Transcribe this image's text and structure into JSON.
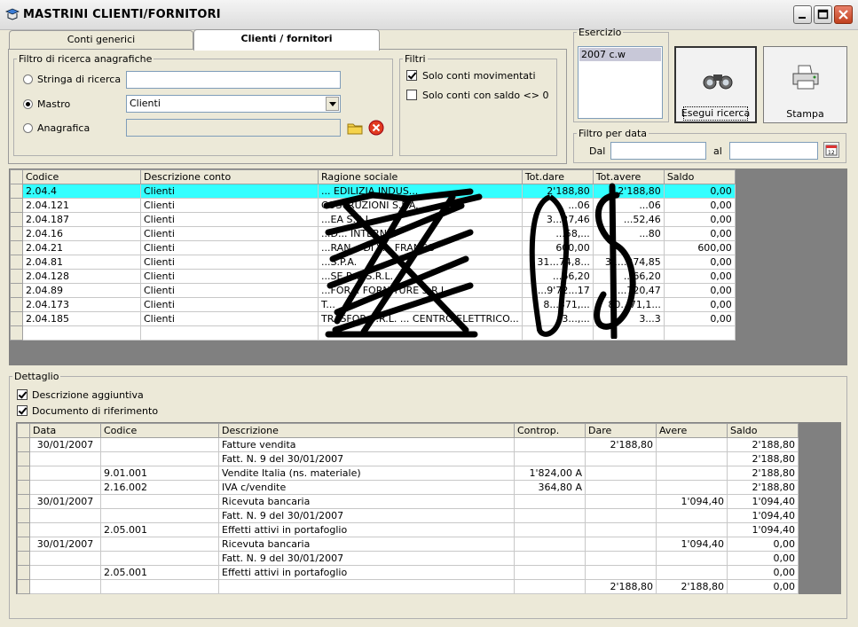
{
  "window": {
    "title": "MASTRINI CLIENTI/FORNITORI"
  },
  "tabs": [
    {
      "label": "Conti generici"
    },
    {
      "label": "Clienti / fornitori"
    }
  ],
  "filtro_anagrafiche": {
    "legend": "Filtro di ricerca anagrafiche",
    "stringa_label": "Stringa di ricerca",
    "stringa_value": "",
    "mastro_label": "Mastro",
    "mastro_value": "Clienti",
    "anagrafica_label": "Anagrafica",
    "anagrafica_value": ""
  },
  "filtri": {
    "legend": "Filtri",
    "solo_movimentati": "Solo conti movimentati",
    "solo_saldo": "Solo conti con saldo <> 0"
  },
  "esercizio": {
    "legend": "Esercizio",
    "items": [
      "2007 c.w"
    ]
  },
  "buttons": {
    "esegui": "Esegui ricerca",
    "stampa": "Stampa"
  },
  "filtro_data": {
    "legend": "Filtro per data",
    "dal_label": "Dal",
    "al_label": "al",
    "dal_value": "",
    "al_value": ""
  },
  "conti_table": {
    "headers": [
      "Codice",
      "Descrizione conto",
      "Ragione sociale",
      "Tot.dare",
      "Tot.avere",
      "Saldo"
    ],
    "rows": [
      [
        "2.04.4",
        "Clienti",
        "... EDILIZIA INDUS...",
        "2'188,80",
        "2'188,80",
        "0,00"
      ],
      [
        "2.04.121",
        "Clienti",
        "COSTRUZIONI S.P.A.",
        "...06",
        "...06",
        "0,00"
      ],
      [
        "2.04.187",
        "Clienti",
        "...EA S.R.L.",
        "3...27,46",
        "...52,46",
        "0,00"
      ],
      [
        "2.04.16",
        "Clienti",
        "...D... INTERN...",
        "...58,...",
        "...80",
        "0,00"
      ],
      [
        "2.04.21",
        "Clienti",
        "...RAN... DI V... FRANCO",
        "600,00",
        "",
        "600,00"
      ],
      [
        "2.04.81",
        "Clienti",
        "...S.P.A.",
        "31...74,8...",
        "31...274,85",
        "0,00"
      ],
      [
        "2.04.128",
        "Clienti",
        "...SE P.... S.R.L.",
        "...66,20",
        "...66,20",
        "0,00"
      ],
      [
        "2.04.89",
        "Clienti",
        "...FOR... FORNITURE S.R.L.",
        "...9'72...17",
        "...720,47",
        "0,00"
      ],
      [
        "2.04.173",
        "Clienti",
        "T...",
        "8...371,...",
        "80...71,1...",
        "0,00"
      ],
      [
        "2.04.185",
        "Clienti",
        "TRASFOR S.R.L. ... CENTRO ELETTRICO...",
        "3...,...",
        "3...3",
        "0,00"
      ]
    ]
  },
  "dettaglio": {
    "legend": "Dettaglio",
    "desc_aggiuntiva": "Descrizione aggiuntiva",
    "doc_riferimento": "Documento di riferimento",
    "headers": [
      "Data",
      "Codice",
      "Descrizione",
      "Controp.",
      "Dare",
      "Avere",
      "Saldo"
    ],
    "rows": [
      [
        "30/01/2007",
        "",
        "Fatture vendita",
        "",
        "2'188,80",
        "",
        "2'188,80"
      ],
      [
        "",
        "",
        "Fatt. N. 9 del 30/01/2007",
        "",
        "",
        "",
        "2'188,80"
      ],
      [
        "",
        "9.01.001",
        "Vendite Italia  (ns. materiale)",
        "1'824,00 A",
        "",
        "",
        "2'188,80"
      ],
      [
        "",
        "2.16.002",
        "IVA c/vendite",
        "364,80 A",
        "",
        "",
        "2'188,80"
      ],
      [
        "30/01/2007",
        "",
        "Ricevuta bancaria",
        "",
        "",
        "1'094,40",
        "1'094,40"
      ],
      [
        "",
        "",
        "Fatt. N. 9 del 30/01/2007",
        "",
        "",
        "",
        "1'094,40"
      ],
      [
        "",
        "2.05.001",
        "Effetti attivi in portafoglio",
        "",
        "",
        "",
        "1'094,40"
      ],
      [
        "30/01/2007",
        "",
        "Ricevuta bancaria",
        "",
        "",
        "1'094,40",
        "0,00"
      ],
      [
        "",
        "",
        "Fatt. N. 9 del 30/01/2007",
        "",
        "",
        "",
        "0,00"
      ],
      [
        "",
        "2.05.001",
        "Effetti attivi in portafoglio",
        "",
        "",
        "",
        "0,00"
      ],
      [
        "",
        "",
        "",
        "",
        "2'188,80",
        "2'188,80",
        "0,00"
      ]
    ]
  }
}
